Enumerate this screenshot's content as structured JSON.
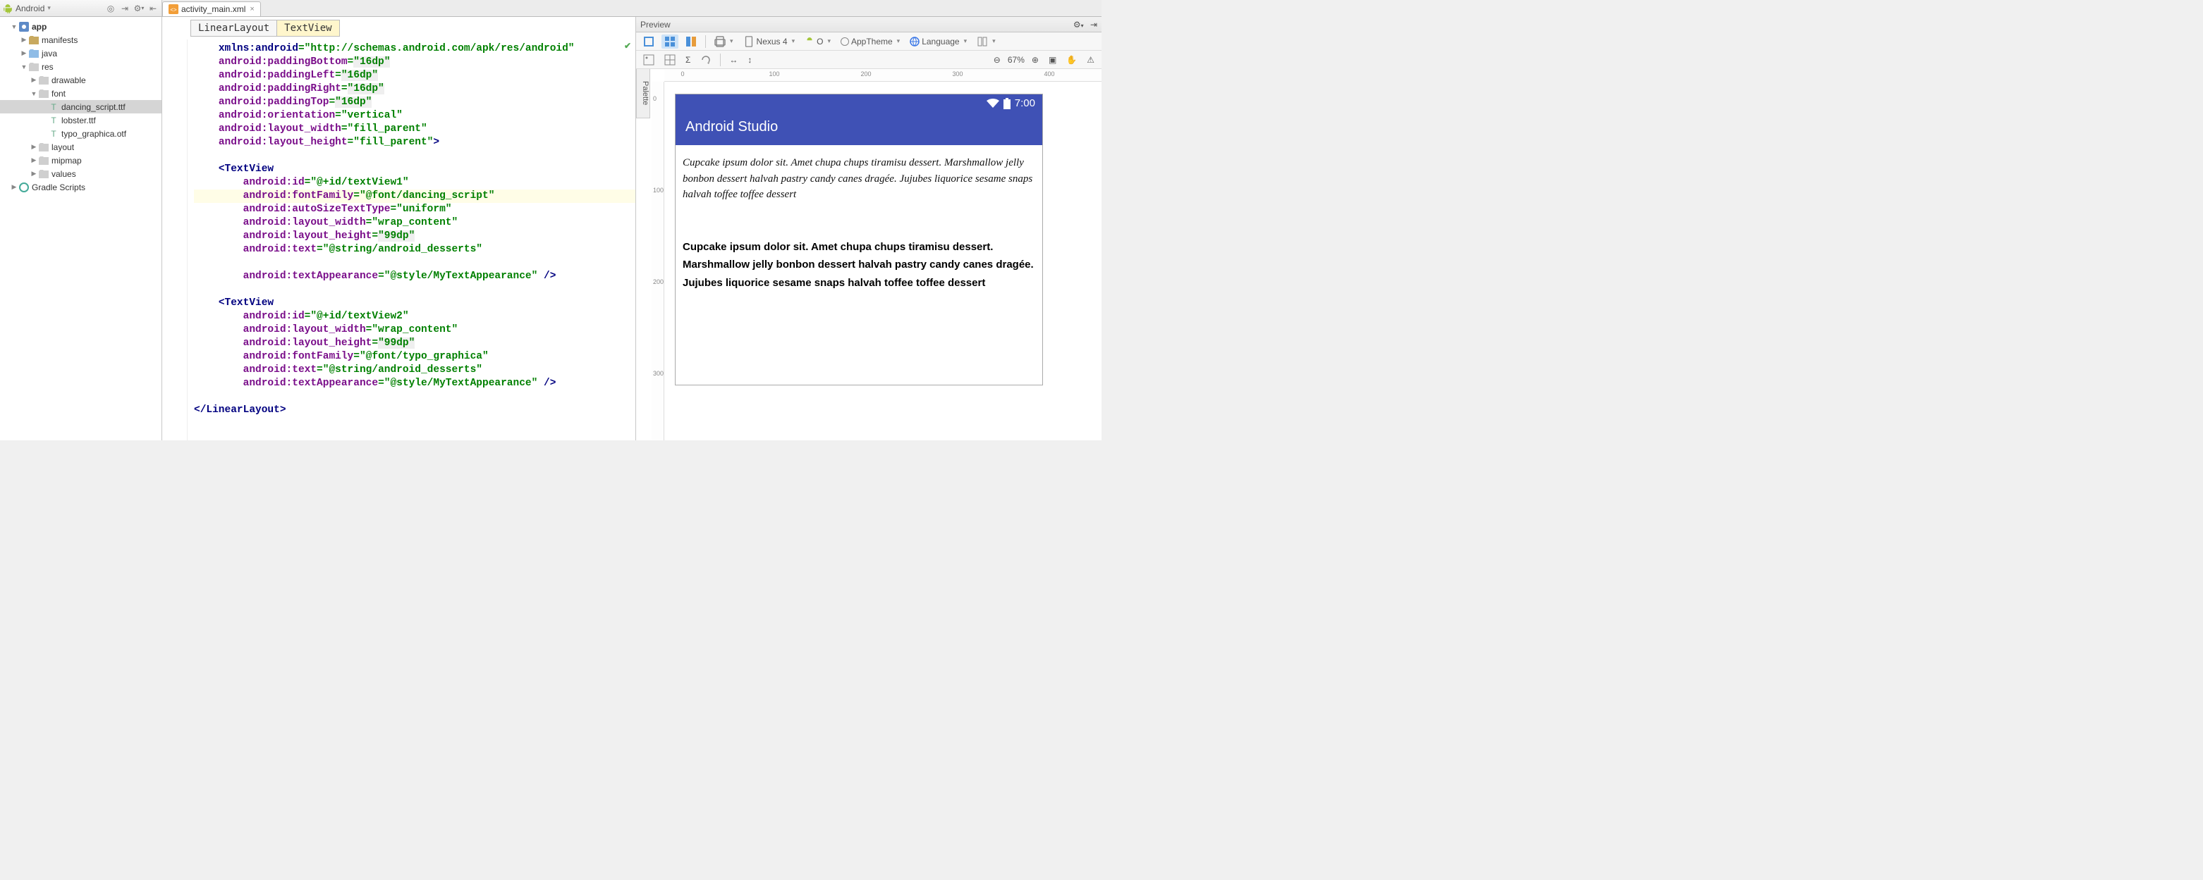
{
  "toolbar": {
    "view": "Android"
  },
  "tab": {
    "filename": "activity_main.xml"
  },
  "tree": {
    "app": "app",
    "manifests": "manifests",
    "java": "java",
    "res": "res",
    "drawable": "drawable",
    "font": "font",
    "font_files": [
      "dancing_script.ttf",
      "lobster.ttf",
      "typo_graphica.otf"
    ],
    "layout": "layout",
    "mipmap": "mipmap",
    "values": "values",
    "gradle": "Gradle Scripts"
  },
  "breadcrumb": {
    "p0": "LinearLayout",
    "p1": "TextView"
  },
  "code": {
    "l1_ns": "xmlns:android",
    "l1_v": "\"http://schemas.android.com/apk/res/android\"",
    "l2_a": "android:paddingBottom",
    "l2_v": "\"16dp\"",
    "l3_a": "android:paddingLeft",
    "l3_v": "\"16dp\"",
    "l4_a": "android:paddingRight",
    "l4_v": "\"16dp\"",
    "l5_a": "android:paddingTop",
    "l5_v": "\"16dp\"",
    "l6_a": "android:orientation",
    "l6_v": "\"vertical\"",
    "l7_a": "android:layout_width",
    "l7_v": "\"fill_parent\"",
    "l8_a": "android:layout_height",
    "l8_v": "\"fill_parent\"",
    "tv": "TextView",
    "t1_id_a": "android:id",
    "t1_id_v": "\"@+id/textView1\"",
    "t1_ff_a": "android:fontFamily",
    "t1_ff_v": "\"@font/dancing_script\"",
    "t1_as_a": "android:autoSizeTextType",
    "t1_as_v": "\"uniform\"",
    "t1_lw_a": "android:layout_width",
    "t1_lw_v": "\"wrap_content\"",
    "t1_lh_a": "android:layout_height",
    "t1_lh_v": "\"99dp\"",
    "t1_tx_a": "android:text",
    "t1_tx_v": "\"@string/android_desserts\"",
    "t1_ta_a": "android:textAppearance",
    "t1_ta_v": "\"@style/MyTextAppearance\"",
    "t2_id_a": "android:id",
    "t2_id_v": "\"@+id/textView2\"",
    "t2_lw_a": "android:layout_width",
    "t2_lw_v": "\"wrap_content\"",
    "t2_lh_a": "android:layout_height",
    "t2_lh_v": "\"99dp\"",
    "t2_ff_a": "android:fontFamily",
    "t2_ff_v": "\"@font/typo_graphica\"",
    "t2_tx_a": "android:text",
    "t2_tx_v": "\"@string/android_desserts\"",
    "t2_ta_a": "android:textAppearance",
    "t2_ta_v": "\"@style/MyTextAppearance\"",
    "close": "LinearLayout"
  },
  "preview": {
    "title": "Preview",
    "device": "Nexus 4",
    "api": "O",
    "theme": "AppTheme",
    "lang": "Language",
    "zoom": "67%",
    "statusbar_time": "7:00",
    "app_title": "Android Studio",
    "text1": "Cupcake ipsum dolor sit. Amet chupa chups tiramisu dessert. Marshmallow jelly bonbon dessert halvah pastry candy canes dragée. Jujubes liquorice sesame snaps halvah toffee toffee dessert",
    "text2": "Cupcake ipsum dolor sit. Amet chupa chups tiramisu dessert. Marshmallow jelly bonbon dessert halvah pastry candy canes dragée. Jujubes liquorice sesame snaps halvah toffee toffee dessert"
  },
  "ruler": {
    "h": [
      "0",
      "100",
      "200",
      "300",
      "400"
    ],
    "v": [
      "0",
      "100",
      "200",
      "300"
    ]
  }
}
